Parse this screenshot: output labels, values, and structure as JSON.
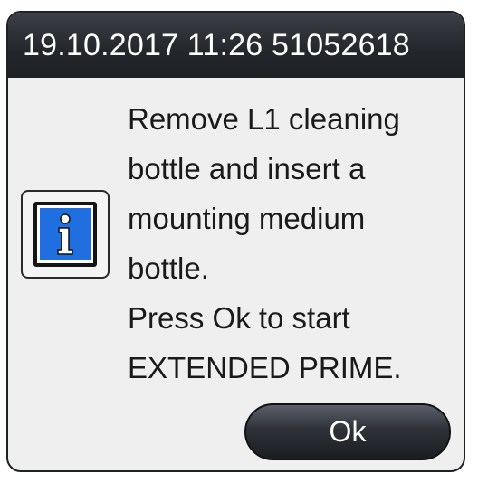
{
  "dialog": {
    "title": "19.10.2017 11:26 51052618",
    "icon": "info-icon",
    "message": "Remove L1 cleaning\nbottle and insert a\nmounting medium\nbottle.\nPress Ok to start\nEXTENDED PRIME.",
    "ok_label": "Ok"
  },
  "colors": {
    "title_bar": "#23262b",
    "dialog_background": "#efefef",
    "icon_blue": "#1f6fe0",
    "button": "#2e3238"
  }
}
